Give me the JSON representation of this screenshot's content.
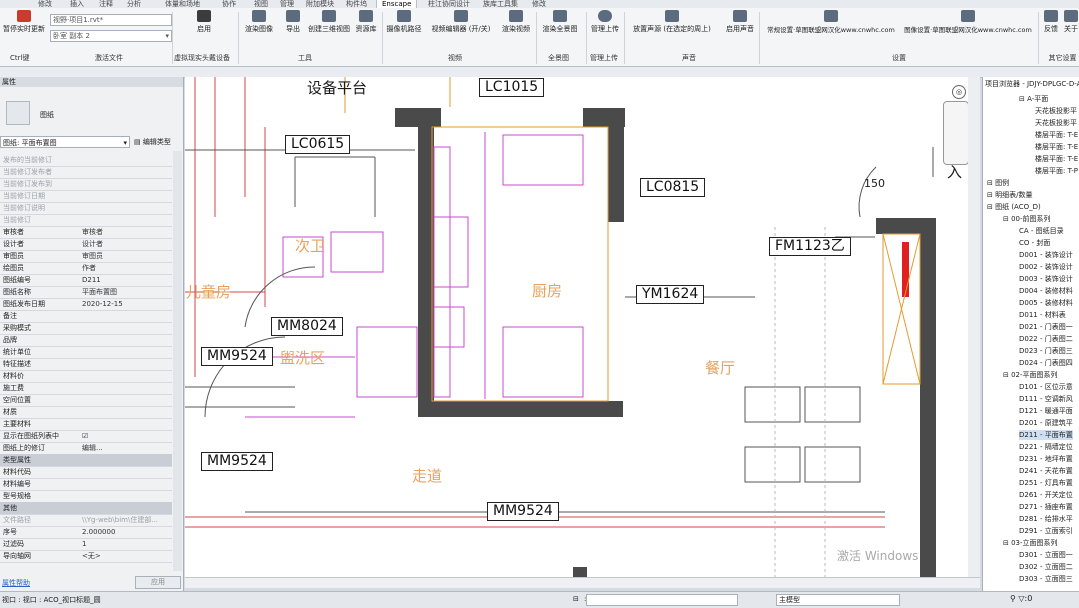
{
  "ribbon": {
    "tabs": [
      "修改",
      "插入",
      "注释",
      "分析",
      "体量和场地",
      "协作",
      "视图",
      "管理",
      "附加模块",
      "构件坞",
      "Enscape",
      "柱江协同设计",
      "族库工具集",
      "修改"
    ],
    "active_tab": "Enscape",
    "project_combo": "视野·项目1.rvt*",
    "view_combo": "卧室 副本 2",
    "buttons": {
      "pause_update": "暂停实时更新",
      "enable": "启用",
      "render_image": "渲染图像",
      "export": "导出",
      "create_3d": "创建三维视图",
      "asset_lib": "资源库",
      "camera_path": "摄像机路径",
      "video_editor": "视频编辑器 (开/关)",
      "render_video": "渲染视频",
      "render_pano": "渲染全景图",
      "manage_upload": "管理上传",
      "place_sound": "放置声源 (在选定的周上)",
      "enable_sound": "启用声音",
      "general_settings": "常规设置·草图联盟网汉化www.cnwhc.com",
      "image_settings": "图像设置·草图联盟网汉化www.cnwhc.com",
      "feedback": "反馈",
      "about": "关于"
    },
    "groups": {
      "ctrl": "Ctrl键",
      "activate": "激活文件",
      "vr": "虚拟现实头戴设备",
      "tools": "工具",
      "video": "视频",
      "pano": "全景图",
      "upload": "管理上传",
      "sound": "声音",
      "settings": "设置",
      "other": "其它设置"
    }
  },
  "properties": {
    "title": "属性",
    "type_name": "图纸",
    "selector": "图纸: 平面布置图",
    "edit_type": "编辑类型",
    "rows": [
      {
        "k": "发布的当前修订",
        "v": "",
        "dim": true
      },
      {
        "k": "当前修订发布者",
        "v": "",
        "dim": true
      },
      {
        "k": "当前修订发布到",
        "v": "",
        "dim": true
      },
      {
        "k": "当前修订日期",
        "v": "",
        "dim": true
      },
      {
        "k": "当前修订说明",
        "v": "",
        "dim": true
      },
      {
        "k": "当前修订",
        "v": "",
        "dim": true
      },
      {
        "k": "审核者",
        "v": "审核者"
      },
      {
        "k": "设计者",
        "v": "设计者"
      },
      {
        "k": "审图员",
        "v": "审图员"
      },
      {
        "k": "绘图员",
        "v": "作者"
      },
      {
        "k": "图纸编号",
        "v": "D211"
      },
      {
        "k": "图纸名称",
        "v": "平面布置图"
      },
      {
        "k": "图纸发布日期",
        "v": "2020-12-15"
      },
      {
        "k": "备注",
        "v": ""
      },
      {
        "k": "采购模式",
        "v": ""
      },
      {
        "k": "品牌",
        "v": ""
      },
      {
        "k": "统计单位",
        "v": ""
      },
      {
        "k": "特征描述",
        "v": ""
      },
      {
        "k": "材料价",
        "v": ""
      },
      {
        "k": "施工费",
        "v": ""
      },
      {
        "k": "空间位置",
        "v": ""
      },
      {
        "k": "材质",
        "v": ""
      },
      {
        "k": "主要材料",
        "v": ""
      },
      {
        "k": "显示在图纸列表中",
        "v": "☑"
      },
      {
        "k": "图纸上的修订",
        "v": "编辑..."
      }
    ],
    "type_group": "类型属性",
    "type_rows": [
      {
        "k": "材料代码",
        "v": ""
      },
      {
        "k": "材料编号",
        "v": ""
      },
      {
        "k": "型号规格",
        "v": ""
      }
    ],
    "other_group": "其他",
    "other_rows": [
      {
        "k": "文件路径",
        "v": "\\\\Yg-web\\bim\\住建部..."
      },
      {
        "k": "序号",
        "v": "2.000000"
      },
      {
        "k": "过滤码",
        "v": "1"
      },
      {
        "k": "导向轴网",
        "v": "<无>"
      }
    ],
    "help": "属性帮助",
    "apply": "应用"
  },
  "canvas": {
    "tags": [
      "LC1015",
      "LC0615",
      "LC0815",
      "FM1123乙",
      "YM1624",
      "MM8024",
      "MM9524",
      "MM9524",
      "MM9524"
    ],
    "rooms": [
      "次卫",
      "儿童房",
      "盥洗区",
      "厨房",
      "餐厅",
      "走道"
    ],
    "dim_label": "150",
    "top_label": "设备平台",
    "entry_label": "入"
  },
  "browser": {
    "title": "项目浏览器 - JDJY-DPLGC-D-A",
    "nodes": [
      {
        "t": "A-平面",
        "d": 2
      },
      {
        "t": "天花板投影平",
        "d": 4
      },
      {
        "t": "天花板投影平",
        "d": 4
      },
      {
        "t": "楼层平面: T-E",
        "d": 4
      },
      {
        "t": "楼层平面: T-E",
        "d": 4
      },
      {
        "t": "楼层平面: T-E",
        "d": 4
      },
      {
        "t": "楼层平面: T-P",
        "d": 4
      },
      {
        "t": "图例",
        "d": 0
      },
      {
        "t": "明细表/数量",
        "d": 0
      },
      {
        "t": "图纸 (ACO_D)",
        "d": 0
      },
      {
        "t": "00-前图系列",
        "d": 1
      },
      {
        "t": "CA - 图纸目录",
        "d": 2
      },
      {
        "t": "CO - 封面",
        "d": 2
      },
      {
        "t": "D001 - 装饰设计",
        "d": 2
      },
      {
        "t": "D002 - 装饰设计",
        "d": 2
      },
      {
        "t": "D003 - 装饰设计",
        "d": 2
      },
      {
        "t": "D004 - 装修材料",
        "d": 2
      },
      {
        "t": "D005 - 装修材料",
        "d": 2
      },
      {
        "t": "D011 - 材料表",
        "d": 2
      },
      {
        "t": "D021 - 门表图一",
        "d": 2
      },
      {
        "t": "D022 - 门表图二",
        "d": 2
      },
      {
        "t": "D023 - 门表图三",
        "d": 2
      },
      {
        "t": "D024 - 门表图四",
        "d": 2
      },
      {
        "t": "02-平面图系列",
        "d": 1
      },
      {
        "t": "D101 - 区位示意",
        "d": 2
      },
      {
        "t": "D111 - 空调新风",
        "d": 2
      },
      {
        "t": "D121 - 暖通平面",
        "d": 2
      },
      {
        "t": "D201 - 原建筑平",
        "d": 2
      },
      {
        "t": "D211 - 平面布置",
        "d": 2,
        "sel": true
      },
      {
        "t": "D221 - 隔墙定位",
        "d": 2
      },
      {
        "t": "D231 - 地坪布置",
        "d": 2
      },
      {
        "t": "D241 - 天花布置",
        "d": 2
      },
      {
        "t": "D251 - 灯具布置",
        "d": 2
      },
      {
        "t": "D261 - 开关定位",
        "d": 2
      },
      {
        "t": "D271 - 插座布置",
        "d": 2
      },
      {
        "t": "D281 - 给排水平",
        "d": 2
      },
      {
        "t": "D291 - 立面索引",
        "d": 2
      },
      {
        "t": "03-立面图系列",
        "d": 1
      },
      {
        "t": "D301 - 立面图一",
        "d": 2
      },
      {
        "t": "D302 - 立面图二",
        "d": 2
      },
      {
        "t": "D303 - 立面图三",
        "d": 2
      }
    ]
  },
  "status": {
    "left": "视口 : 视口 : ACO_视口标题_圆",
    "scale": ":0",
    "model": "主模型"
  },
  "watermark": "激活 Windows"
}
